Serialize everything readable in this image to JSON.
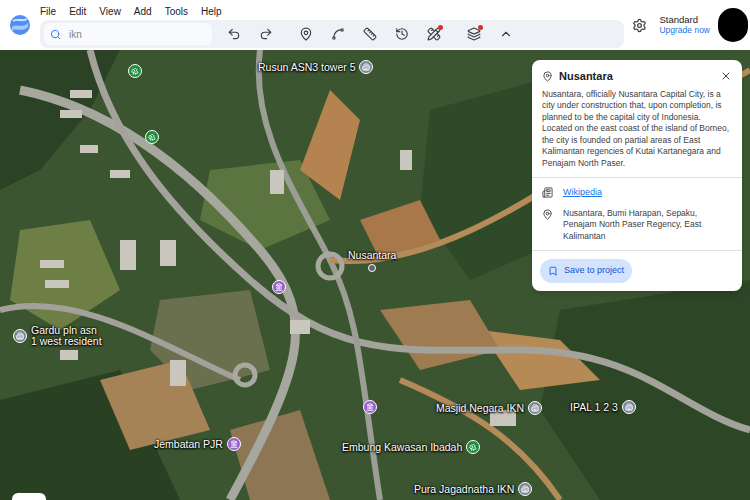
{
  "menu": [
    "File",
    "Edit",
    "View",
    "Add",
    "Tools",
    "Help"
  ],
  "search": {
    "value": "ikn"
  },
  "tools": [
    {
      "dot": false
    },
    {
      "dot": false
    },
    {
      "dot": false
    },
    {
      "dot": false
    },
    {
      "dot": false
    },
    {
      "dot": false
    },
    {
      "dot": true
    },
    {
      "dot": true
    },
    {
      "dot": false
    }
  ],
  "account": {
    "plan": "Standard",
    "upgrade": "Upgrade now"
  },
  "pins": [
    {
      "lines": [],
      "kind": "park",
      "color": "#1e8e3e"
    },
    {
      "lines": [],
      "kind": "park",
      "color": "#1e8e3e"
    },
    {
      "lines": [
        "Rusun ASN3 tower 5"
      ],
      "kind": "building",
      "color": "#7b8794"
    },
    {
      "lines": [
        "Nusantara"
      ],
      "kind": "place",
      "color": "#5f6368"
    },
    {
      "lines": [],
      "kind": "attraction",
      "color": "#9a5fd0"
    },
    {
      "lines": [
        "Gardu pln asn",
        "1 west resident"
      ],
      "kind": "building",
      "color": "#7b8794"
    },
    {
      "lines": [],
      "kind": "attraction",
      "color": "#9a5fd0"
    },
    {
      "lines": [
        "Masjid Negara IKN"
      ],
      "kind": "building",
      "color": "#7b8794"
    },
    {
      "lines": [
        "IPAL 1 2 3"
      ],
      "kind": "building",
      "color": "#7b8794"
    },
    {
      "lines": [
        "Jembatan PJR"
      ],
      "kind": "attraction",
      "color": "#9a5fd0"
    },
    {
      "lines": [
        "Embung Kawasan Ibadah"
      ],
      "kind": "park",
      "color": "#1e8e3e"
    },
    {
      "lines": [
        "Pura Jagadnatha IKN"
      ],
      "kind": "building",
      "color": "#7b8794"
    }
  ],
  "panel": {
    "title": "Nusantara",
    "description": "Nusantara, officially Nusantara Capital City, is a city under construction that, upon completion, is planned to be the capital city of Indonesia. Located on the east coast of the island of Borneo, the city is founded on partial areas of East Kalimantan regencies of Kutai Kartanegara and Penajam North Paser.",
    "link": "Wikipedia",
    "address": "Nusantara, Bumi Harapan, Sepaku, Penajam North Paser Regency, East Kalimantan",
    "button": "Save to project"
  }
}
